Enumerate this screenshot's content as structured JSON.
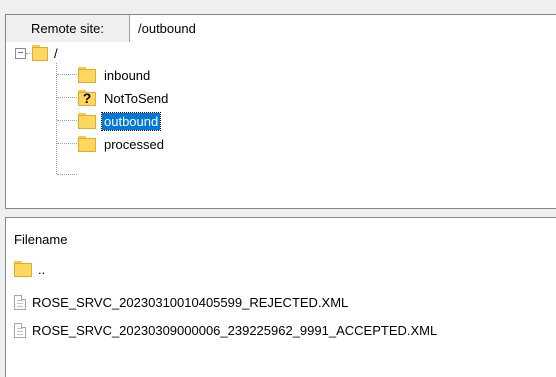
{
  "remote_site": {
    "label": "Remote site:",
    "path": "/outbound"
  },
  "tree": {
    "root": "/",
    "expander": "−",
    "children": [
      {
        "name": "inbound",
        "icon": "folder-icon"
      },
      {
        "name": "NotToSend",
        "icon": "folder-question-icon",
        "badge": "?"
      },
      {
        "name": "outbound",
        "icon": "folder-icon",
        "selected": true
      },
      {
        "name": "processed",
        "icon": "folder-icon"
      }
    ]
  },
  "file_list": {
    "column_header": "Filename",
    "rows": [
      {
        "name": "..",
        "icon": "folder-icon"
      },
      {
        "name": "ROSE_SRVC_20230310010405599_REJECTED.XML",
        "icon": "file-icon"
      },
      {
        "name": "ROSE_SRVC_20230309000006_239225962_9991_ACCEPTED.XML",
        "icon": "file-icon"
      }
    ]
  },
  "colors": {
    "selection": "#0078d7",
    "folder": "#ffd65e"
  }
}
